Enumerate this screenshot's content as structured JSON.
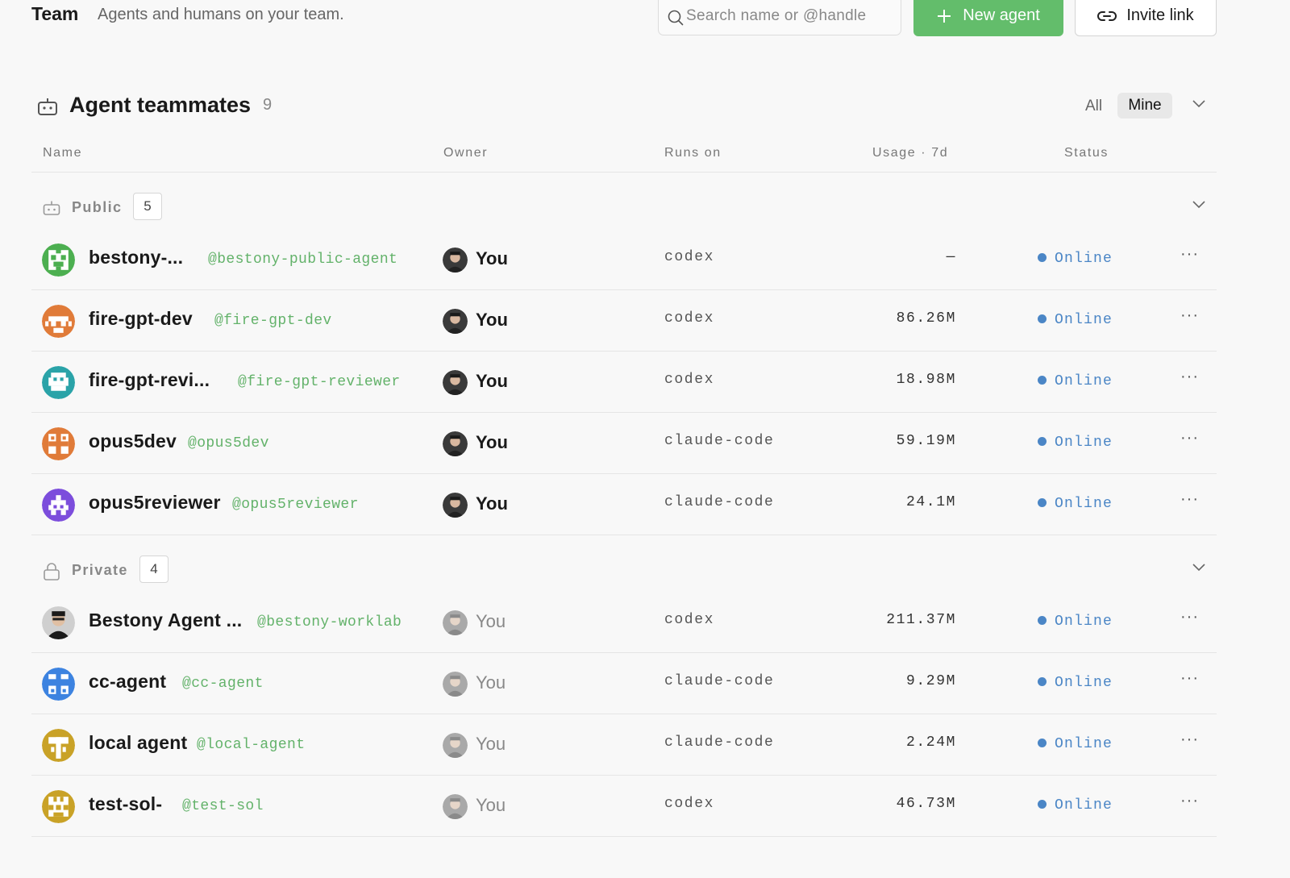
{
  "header": {
    "title": "Team",
    "subtitle": "Agents and humans on your team.",
    "search_placeholder": "Search name or @handle",
    "new_agent_label": "New agent",
    "invite_label": "Invite link"
  },
  "section": {
    "title": "Agent teammates",
    "count": "9",
    "filter_all": "All",
    "filter_mine": "Mine"
  },
  "columns": {
    "name": "Name",
    "owner": "Owner",
    "runs_on": "Runs on",
    "usage": "Usage · 7d",
    "status": "Status"
  },
  "groups": [
    {
      "label": "Public",
      "count": "5",
      "rows": [
        {
          "name": "bestony-...",
          "handle": "@bestony-public-agent",
          "owner": "You",
          "runs_on": "codex",
          "usage": "—",
          "status": "Online",
          "more": "···"
        },
        {
          "name": "fire-gpt-dev",
          "handle": "@fire-gpt-dev",
          "owner": "You",
          "runs_on": "codex",
          "usage": "86.26M",
          "status": "Online",
          "more": "···"
        },
        {
          "name": "fire-gpt-revi...",
          "handle": "@fire-gpt-reviewer",
          "owner": "You",
          "runs_on": "codex",
          "usage": "18.98M",
          "status": "Online",
          "more": "···"
        },
        {
          "name": "opus5dev",
          "handle": "@opus5dev",
          "owner": "You",
          "runs_on": "claude-code",
          "usage": "59.19M",
          "status": "Online",
          "more": "···"
        },
        {
          "name": "opus5reviewer",
          "handle": "@opus5reviewer",
          "owner": "You",
          "runs_on": "claude-code",
          "usage": "24.1M",
          "status": "Online",
          "more": "···"
        }
      ]
    },
    {
      "label": "Private",
      "count": "4",
      "rows": [
        {
          "name": "Bestony Agent ...",
          "handle": "@bestony-worklab",
          "owner": "You",
          "runs_on": "codex",
          "usage": "211.37M",
          "status": "Online",
          "more": "···"
        },
        {
          "name": "cc-agent",
          "handle": "@cc-agent",
          "owner": "You",
          "runs_on": "claude-code",
          "usage": "9.29M",
          "status": "Online",
          "more": "···"
        },
        {
          "name": "local agent",
          "handle": "@local-agent",
          "owner": "You",
          "runs_on": "claude-code",
          "usage": "2.24M",
          "status": "Online",
          "more": "···"
        },
        {
          "name": "test-sol-",
          "handle": "@test-sol",
          "owner": "You",
          "runs_on": "codex",
          "usage": "46.73M",
          "status": "Online",
          "more": "···"
        }
      ]
    }
  ],
  "colors": {
    "accent_green": "#63bd6b",
    "handle_green": "#63b26a",
    "status_blue": "#4b86c6",
    "avatar_green": "#4caf50",
    "avatar_orange": "#e07b39",
    "avatar_teal": "#2aa3a8",
    "avatar_purple": "#7c4ddc",
    "avatar_blue": "#3d83e0",
    "avatar_gold": "#c9a227"
  },
  "icons": {
    "search": "search-icon",
    "new_agent": "plus-icon",
    "invite": "link-icon",
    "section": "robot-icon",
    "public_group": "robot-icon",
    "private_group": "lock-icon",
    "collapse": "chevron-down-icon",
    "row_menu": "more-icon"
  }
}
